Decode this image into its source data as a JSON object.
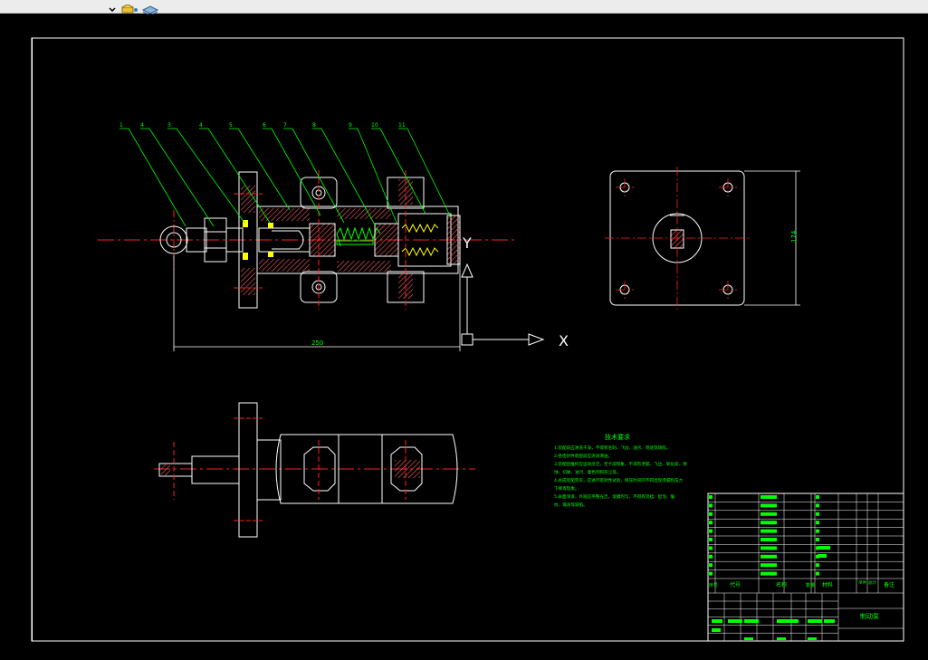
{
  "toolbar": {
    "items": [
      {
        "icon": "chevron-down-icon"
      },
      {
        "icon": "layer-icon"
      },
      {
        "icon": "layers-stack-icon"
      }
    ]
  },
  "drawing": {
    "dimension_length": "250",
    "dimension_height": "174",
    "ucs_x_label": "X",
    "ucs_y_label": "Y",
    "part_callouts": [
      "1",
      "4",
      "3",
      "4",
      "5",
      "6",
      "7",
      "8",
      "9",
      "10",
      "11"
    ],
    "notes_title": "技术要求",
    "notes_lines": [
      "1.装配前应清洗干净，不得有毛刺、飞边、油污、锈迹等缺陷。",
      "2.各密封件装配前应涂润滑油。",
      "3.装配后推杆应运动灵活，无卡滞现象，不得有泄漏、飞边、氧化皮、锈",
      "蚀、切屑、油污、着色剂和灰尘等。",
      "4.总成装配完毕，应进行密封性试验，保压时间内不得出现渗漏和压力",
      "下降等现象。",
      "5.表面涂漆，外观应平整光洁，漆膜均匀，不得有流挂、起泡、皱",
      "纹、漏涂等缺陷。"
    ]
  },
  "title_block": {
    "header_labels": [
      "序号",
      "代号",
      "名称",
      "数量",
      "材料",
      "单件",
      "总计",
      "备注"
    ],
    "drawing_title": "制动泵"
  },
  "colors": {
    "outline": "#ffffff",
    "centerline": "#ff2020",
    "leader": "#00ff00",
    "hatch": "#ff6060",
    "dimension": "#00ff00",
    "seal": "#ffff00"
  }
}
